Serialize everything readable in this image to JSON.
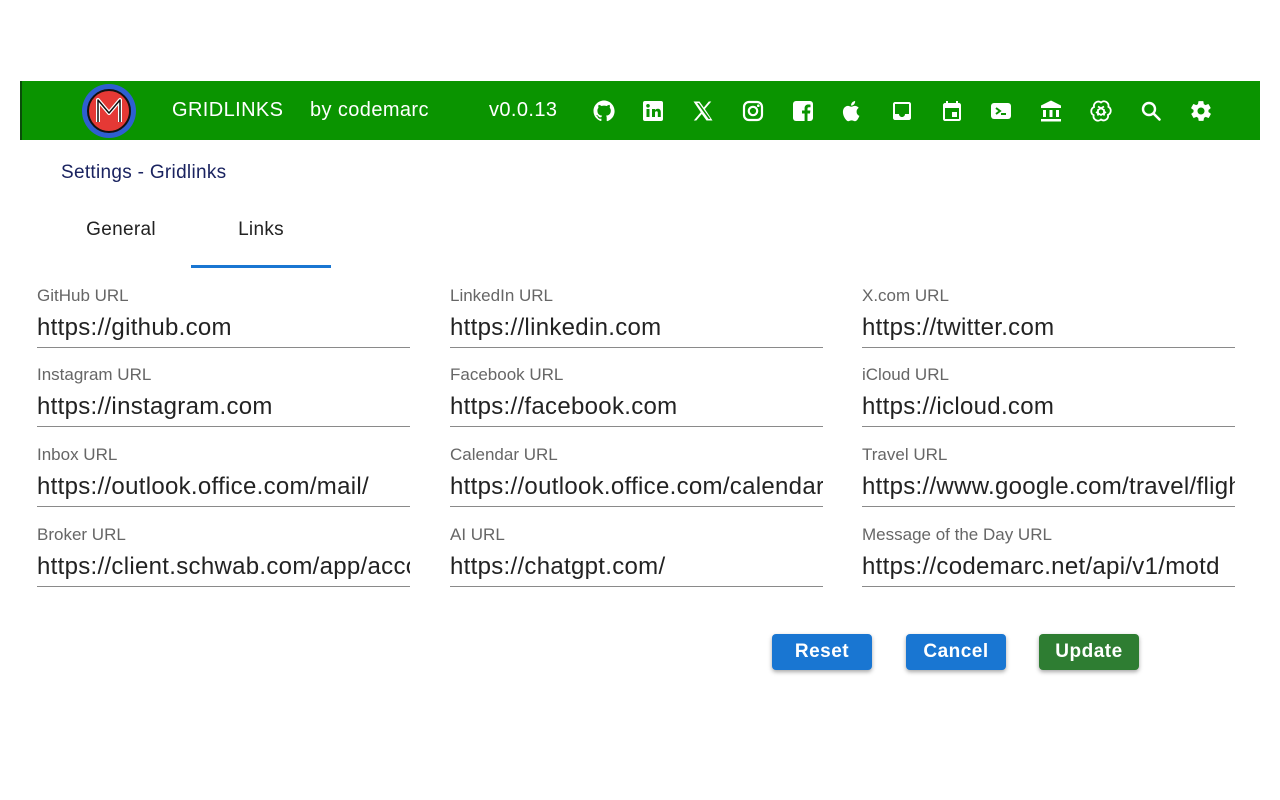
{
  "header": {
    "title": "GRIDLINKS",
    "by": "by codemarc",
    "version": "v0.0.13",
    "background": "#0a9400",
    "icons": [
      "github-icon",
      "linkedin-icon",
      "x-icon",
      "instagram-icon",
      "facebook-icon",
      "apple-icon",
      "inbox-icon",
      "calendar-icon",
      "travel-icon",
      "bank-icon",
      "openai-icon",
      "search-icon",
      "gear-icon"
    ]
  },
  "settings": {
    "title": "Settings - Gridlinks"
  },
  "tabs": [
    {
      "label": "General",
      "active": false
    },
    {
      "label": "Links",
      "active": true
    }
  ],
  "fields": [
    {
      "label": "GitHub URL",
      "value": "https://github.com"
    },
    {
      "label": "LinkedIn URL",
      "value": "https://linkedin.com"
    },
    {
      "label": "X.com URL",
      "value": "https://twitter.com"
    },
    {
      "label": "Instagram URL",
      "value": "https://instagram.com"
    },
    {
      "label": "Facebook URL",
      "value": "https://facebook.com"
    },
    {
      "label": "iCloud URL",
      "value": "https://icloud.com"
    },
    {
      "label": "Inbox URL",
      "value": "https://outlook.office.com/mail/"
    },
    {
      "label": "Calendar URL",
      "value": "https://outlook.office.com/calendar"
    },
    {
      "label": "Travel URL",
      "value": "https://www.google.com/travel/flights"
    },
    {
      "label": "Broker URL",
      "value": "https://client.schwab.com/app/accounts"
    },
    {
      "label": "AI URL",
      "value": "https://chatgpt.com/"
    },
    {
      "label": "Message of the Day URL",
      "value": "https://codemarc.net/api/v1/motd"
    }
  ],
  "buttons": {
    "reset": "Reset",
    "cancel": "Cancel",
    "update": "Update"
  },
  "colors": {
    "primary": "#1976d2",
    "success": "#2e7d32",
    "header": "#0a9400"
  }
}
